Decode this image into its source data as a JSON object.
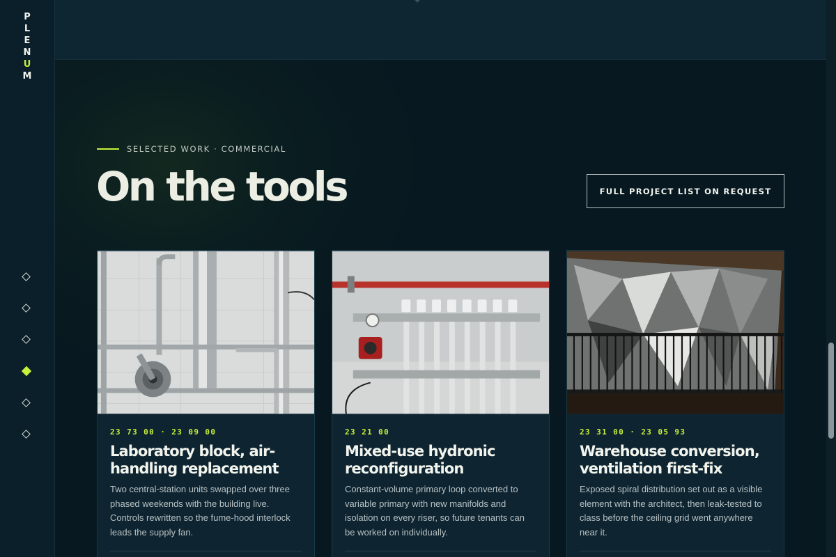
{
  "brand": {
    "letters": [
      "P",
      "L",
      "E",
      "N",
      "U",
      "M"
    ],
    "accent_letter_index": 4,
    "accent_color": "#c6f03a"
  },
  "nav": {
    "dots": 6,
    "active_index": 3
  },
  "section": {
    "eyebrow": "SELECTED WORK · COMMERCIAL",
    "title": "On the tools",
    "cta_label": "FULL PROJECT LIST ON REQUEST"
  },
  "cards": [
    {
      "image_alt": "stainless steel laboratory air-handling pipework",
      "meta": "23 73 00 · 23 09 00",
      "title": "Laboratory block, air-handling replacement",
      "description": "Two central-station units swapped over three phased weekends with the building live. Controls rewritten so the fume-hood interlock leads the supply fan."
    },
    {
      "image_alt": "hydronic manifold with red pump and white valve caps",
      "meta": "23 21 00",
      "title": "Mixed-use hydronic reconfiguration",
      "description": "Constant-volume primary loop converted to variable primary with new manifolds and isolation on every riser, so future tenants can be worked on individually."
    },
    {
      "image_alt": "galvanized ductwork behind a black railing",
      "meta": "23 31 00 · 23 05 93",
      "title": "Warehouse conversion, ventilation first-fix",
      "description": "Exposed spiral distribution set out as a visible element with the architect, then leak-tested to class before the ceiling grid went anywhere near it."
    }
  ],
  "colors": {
    "background": "#071820",
    "card": "#0e2430",
    "accent": "#c6f03a"
  }
}
